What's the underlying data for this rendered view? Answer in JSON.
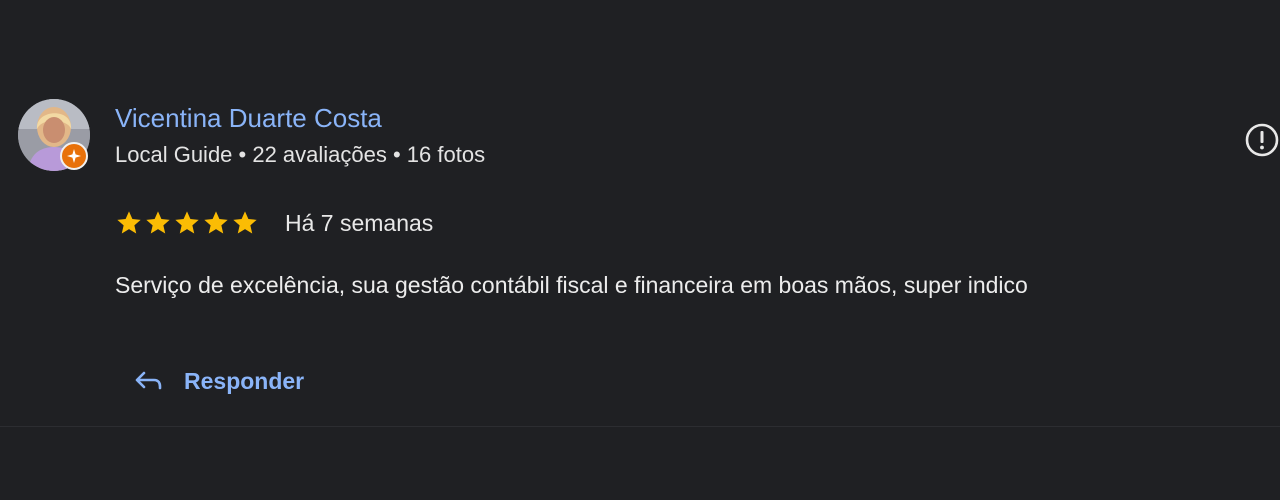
{
  "review": {
    "reviewer": {
      "name": "Vicentina Duarte Costa",
      "meta": "Local Guide • 22 avaliações • 16 fotos",
      "avatar_icon": "user-photo-icon",
      "badge_icon": "local-guide-star-icon"
    },
    "rating": {
      "stars": 5,
      "max_stars": 5,
      "star_color": "#fbbc04"
    },
    "date": "Há 7 semanas",
    "text": "Serviço de excelência, sua gestão contábil fiscal e financeira em boas mãos, super indico",
    "report_icon": "alert-circle-icon"
  },
  "actions": {
    "reply_label": "Responder",
    "reply_icon": "reply-arrow-icon"
  },
  "colors": {
    "background": "#1f2023",
    "link": "#8ab4f8",
    "text": "#e8e8e8",
    "badge": "#e8710a"
  }
}
